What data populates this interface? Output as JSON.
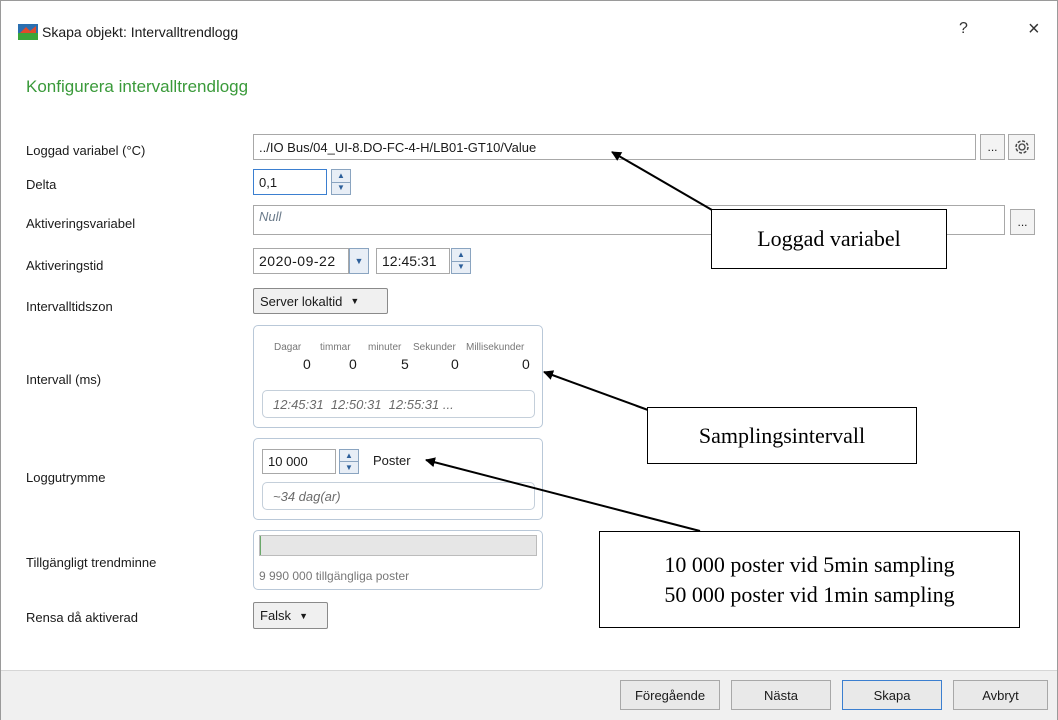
{
  "window": {
    "title": "Skapa objekt: Intervalltrendlogg",
    "help": "?",
    "close": "×"
  },
  "heading": "Konfigurera intervalltrendlogg",
  "rows": {
    "loggad": {
      "label": "Loggad variabel (°C)",
      "value": "../IO Bus/04_UI-8.DO-FC-4-H/LB01-GT10/Value",
      "browse": "..."
    },
    "delta": {
      "label": "Delta",
      "value": "0,1"
    },
    "aktvar": {
      "label": "Aktiveringsvariabel",
      "value": "Null",
      "browse": "..."
    },
    "akttid": {
      "label": "Aktiveringstid",
      "date": "2020-09-22",
      "time": "12:45:31"
    },
    "tidszon": {
      "label": "Intervalltidszon",
      "value": "Server lokaltid"
    },
    "intervall": {
      "label": "Intervall (ms)",
      "units": [
        {
          "label": "Dagar",
          "value": "0"
        },
        {
          "label": "timmar",
          "value": "0"
        },
        {
          "label": "minuter",
          "value": "5"
        },
        {
          "label": "Sekunder",
          "value": "0"
        },
        {
          "label": "Millisekunder",
          "value": "0"
        }
      ],
      "preview": "12:45:31  12:50:31  12:55:31 ..."
    },
    "utrymme": {
      "label": "Loggutrymme",
      "value": "10 000",
      "unit": "Poster",
      "estimate": "~34 dag(ar)"
    },
    "trendminne": {
      "label": "Tillgängligt trendminne",
      "available": "9 990 000 tillgängliga poster",
      "usage_fraction": 0.001
    },
    "rensa": {
      "label": "Rensa då aktiverad",
      "value": "Falsk"
    }
  },
  "annotations": {
    "loggad": "Loggad variabel",
    "sampling": "Samplingsintervall",
    "poster_line1": "10 000 poster vid 5min sampling",
    "poster_line2": "50 000 poster vid 1min sampling"
  },
  "footer": {
    "prev": "Föregående",
    "next": "Nästa",
    "create": "Skapa",
    "cancel": "Avbryt"
  },
  "colors": {
    "heading": "#3a9a3a",
    "primary_border": "#3b7fd0",
    "spin_accent": "#2d5f9a"
  },
  "icons": [
    "app-icon",
    "gear-icon",
    "arrow-up-icon",
    "arrow-down-icon",
    "chevron-down-icon",
    "calendar-dropdown-icon"
  ]
}
